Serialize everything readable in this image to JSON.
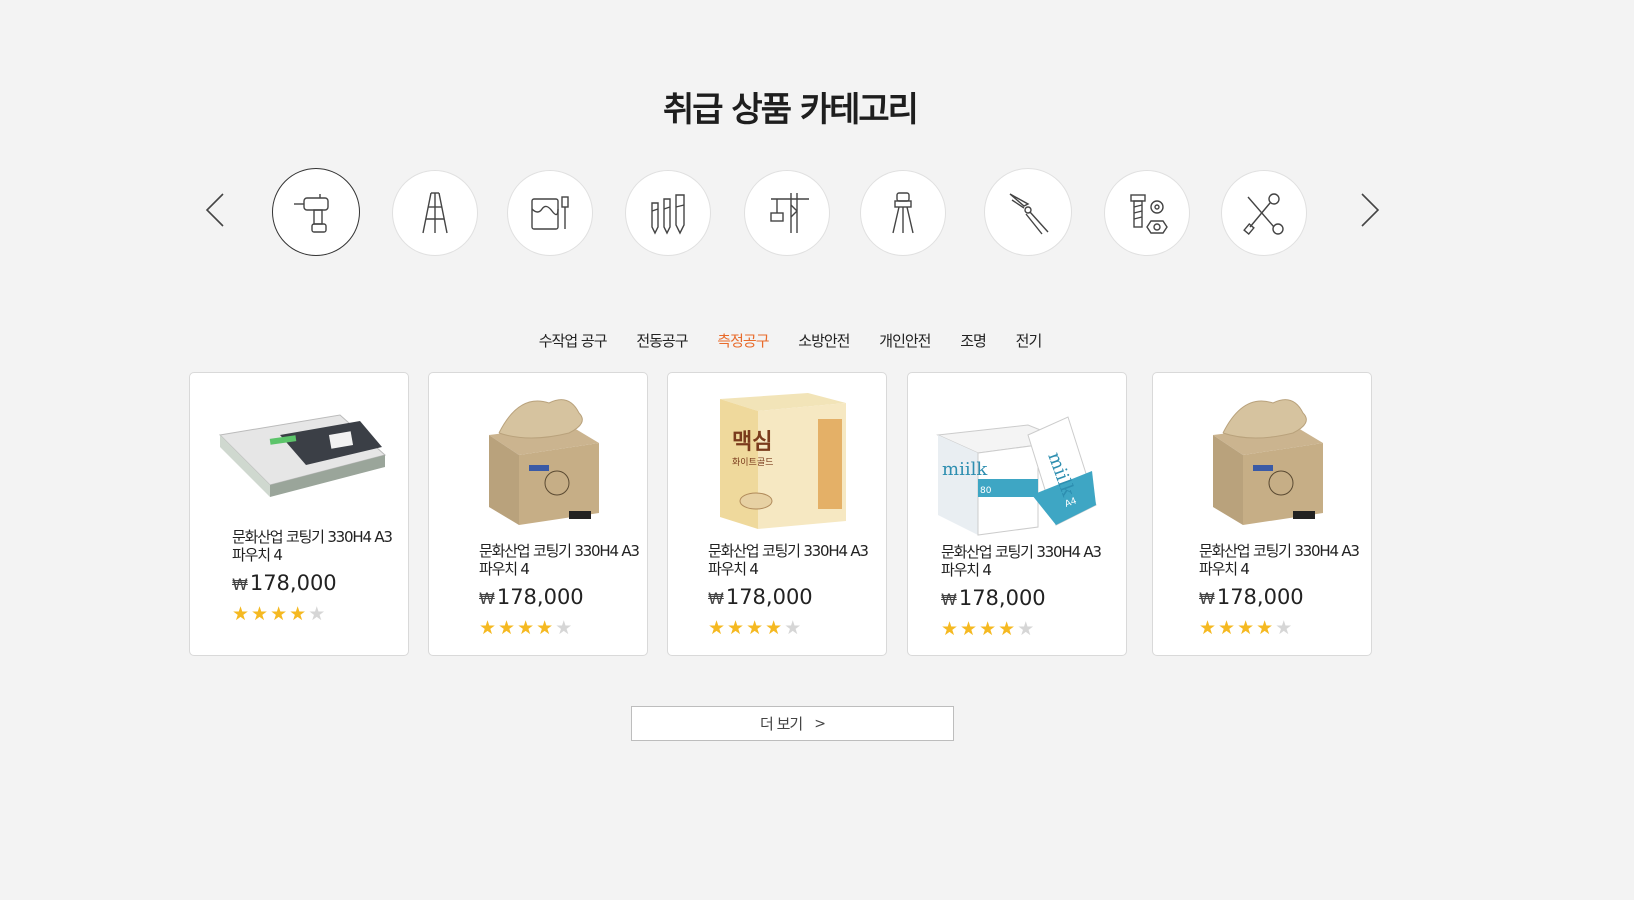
{
  "section": {
    "title": "취급 상품 카테고리"
  },
  "categories": [
    {
      "icon": "drill-icon",
      "active": true
    },
    {
      "icon": "ladder-icon",
      "active": false
    },
    {
      "icon": "paint-bucket-icon",
      "active": false
    },
    {
      "icon": "bolts-icon",
      "active": false
    },
    {
      "icon": "crane-icon",
      "active": false
    },
    {
      "icon": "tripod-icon",
      "active": false
    },
    {
      "icon": "pliers-icon",
      "active": false
    },
    {
      "icon": "screw-nut-icon",
      "active": false
    },
    {
      "icon": "wrench-screwdriver-icon",
      "active": false
    }
  ],
  "tabs": [
    {
      "label": "수작업 공구",
      "active": false
    },
    {
      "label": "전동공구",
      "active": false
    },
    {
      "label": "측정공구",
      "active": true
    },
    {
      "label": "소방안전",
      "active": false
    },
    {
      "label": "개인안전",
      "active": false
    },
    {
      "label": "조명",
      "active": false
    },
    {
      "label": "전기",
      "active": false
    }
  ],
  "products": [
    {
      "name": "문화산업 코팅기 330H4 A3 파우치 4",
      "currency": "₩",
      "price": "178,000",
      "rating": 4,
      "image": "laminator"
    },
    {
      "name": "문화산업 코팅기 330H4 A3 파우치 4",
      "currency": "₩",
      "price": "178,000",
      "rating": 4,
      "image": "tissue-box"
    },
    {
      "name": "문화산업 코팅기 330H4 A3 파우치 4",
      "currency": "₩",
      "price": "178,000",
      "rating": 4,
      "image": "coffee-box"
    },
    {
      "name": "문화산업 코팅기 330H4 A3 파우치 4",
      "currency": "₩",
      "price": "178,000",
      "rating": 4,
      "image": "paper-box"
    },
    {
      "name": "문화산업 코팅기 330H4 A3 파우치 4",
      "currency": "₩",
      "price": "178,000",
      "rating": 4,
      "image": "tissue-box"
    }
  ],
  "product_image_text": {
    "coffee_brand": "맥심",
    "coffee_sub": "화이트골드",
    "paper_brand": "miilk",
    "paper_weight": "80",
    "paper_size": "A4"
  },
  "more_button": {
    "label": "더 보기",
    "chevron": ">"
  },
  "colors": {
    "accent": "#e86b2b",
    "star": "#f5b921",
    "star_off": "#d6d6d6"
  }
}
